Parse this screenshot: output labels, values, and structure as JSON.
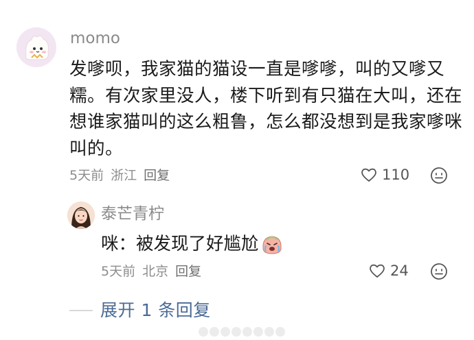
{
  "main_comment": {
    "username": "momo",
    "body": "发嗲呗，我家猫的猫设一直是嗲嗲，叫的又嗲又糯。有次家里没人，楼下听到有只猫在大叫，还在想谁家猫叫的这么粗鲁，怎么都没想到是我家嗲咪叫的。",
    "time": "5天前",
    "location": "浙江",
    "reply_label": "回复",
    "like_count": "110",
    "like_icon": "heart-outline-icon",
    "emoji_icon": "smile-face-icon"
  },
  "reply": {
    "username": "泰芒青柠",
    "body": "咪：被发现了好尴尬",
    "body_emoji": "embarrassed-crying-face-icon",
    "time": "5天前",
    "location": "北京",
    "reply_label": "回复",
    "like_count": "24"
  },
  "expand": {
    "label": "展开 1 条回复"
  },
  "colors": {
    "meta_gray": "#8d8d8d",
    "link_blue": "#4a6a95",
    "text": "#1a1a1a"
  }
}
